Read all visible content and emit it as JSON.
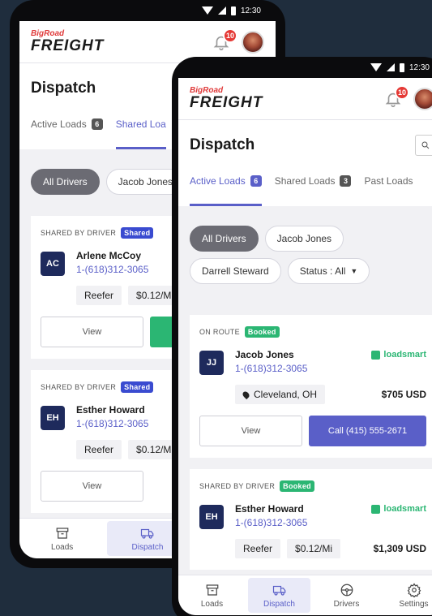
{
  "status_bar": {
    "time": "12:30"
  },
  "brand": {
    "top": "BigRoad",
    "main": "FREIGHT"
  },
  "notifications": {
    "count": "10"
  },
  "page": {
    "title": "Dispatch"
  },
  "tabs": {
    "active_label": "Active Loads",
    "active_count": "6",
    "shared_label": "Shared Loads",
    "shared_count": "3",
    "past_label": "Past Loads",
    "back_shared_label": "Shared Loa"
  },
  "filters": {
    "all_drivers": "All Drivers",
    "jacob": "Jacob Jones",
    "darrell": "Darrell Steward",
    "status": "Status : All"
  },
  "back_cards": [
    {
      "status": "SHARED BY DRIVER",
      "badge": "Shared",
      "initials": "AC",
      "name": "Arlene McCoy",
      "phone": "1-(618)312-3065",
      "tag": "Reefer",
      "rate": "$0.12/Mi",
      "view": "View"
    },
    {
      "status": "SHARED BY DRIVER",
      "badge": "Shared",
      "initials": "EH",
      "name": "Esther Howard",
      "phone": "1-(618)312-3065",
      "tag": "Reefer",
      "rate": "$0.12/Mi",
      "view": "View"
    }
  ],
  "front_cards": [
    {
      "status": "ON ROUTE",
      "badge": "Booked",
      "initials": "JJ",
      "name": "Jacob Jones",
      "phone": "1-(618)312-3065",
      "partner": "loadsmart",
      "location": "Cleveland, OH",
      "amount": "$705 USD",
      "view": "View",
      "call": "Call (415) 555-2671"
    },
    {
      "status": "SHARED BY DRIVER",
      "badge": "Booked",
      "initials": "EH",
      "name": "Esther Howard",
      "phone": "1-(618)312-3065",
      "partner": "loadsmart",
      "tag": "Reefer",
      "rate": "$0.12/Mi",
      "amount": "$1,309 USD"
    }
  ],
  "nav": {
    "loads": "Loads",
    "dispatch": "Dispatch",
    "drivers": "Drivers",
    "settings": "Settings"
  },
  "colors": {
    "accent": "#5a5fc8",
    "green": "#2bb673",
    "badge_red": "#e53935",
    "shared_pill": "#3a4bd0"
  }
}
